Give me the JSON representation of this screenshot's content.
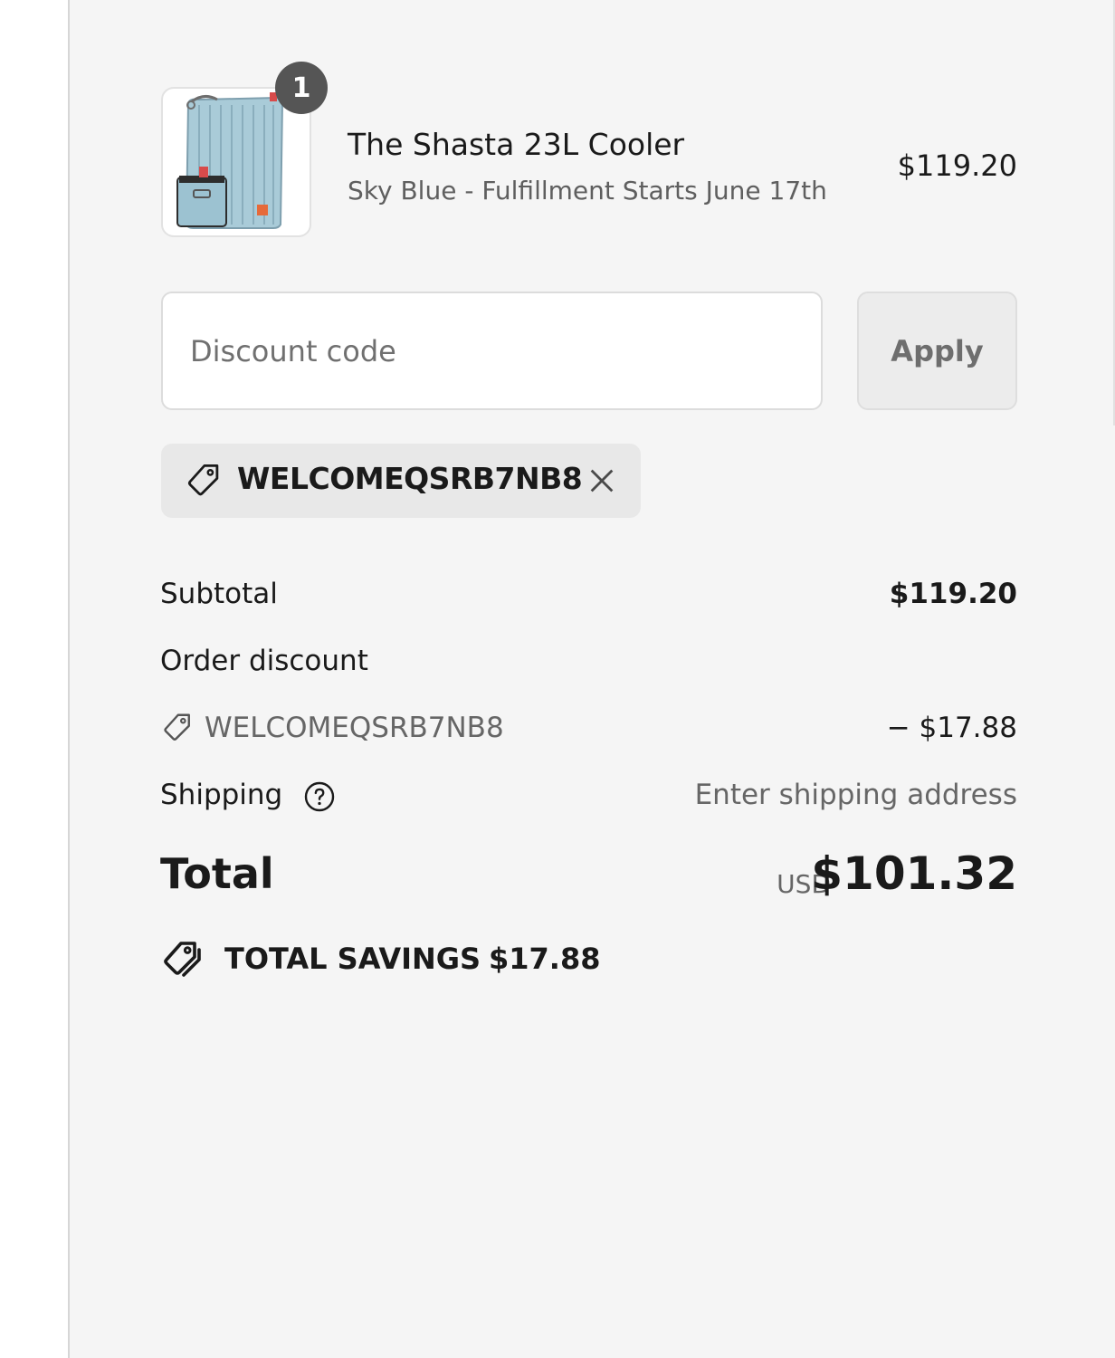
{
  "product": {
    "name": "The Shasta 23L Cooler",
    "variant": "Sky Blue - Fulfillment Starts June 17th",
    "price": "$119.20",
    "quantity": "1",
    "image_icon": "cooler-bag-image"
  },
  "discount": {
    "placeholder": "Discount code",
    "value": "",
    "apply_label": "Apply",
    "applied_code": "WELCOMEQSRB7NB8"
  },
  "summary": {
    "subtotal_label": "Subtotal",
    "subtotal_value": "$119.20",
    "order_discount_label": "Order discount",
    "discount_code": "WELCOMEQSRB7NB8",
    "discount_value": "− $17.88",
    "shipping_label": "Shipping",
    "shipping_value": "Enter shipping address",
    "total_label": "Total",
    "currency": "USD",
    "total_value": "$101.32",
    "savings_label": "TOTAL SAVINGS",
    "savings_value": "$17.88"
  },
  "colors": {
    "panel_bg": "#f5f5f5",
    "text": "#1a1a1a",
    "muted_text": "#666666",
    "badge_bg": "#555555",
    "chip_bg": "#e8e8e8",
    "product_color": "#a9cbd8"
  }
}
